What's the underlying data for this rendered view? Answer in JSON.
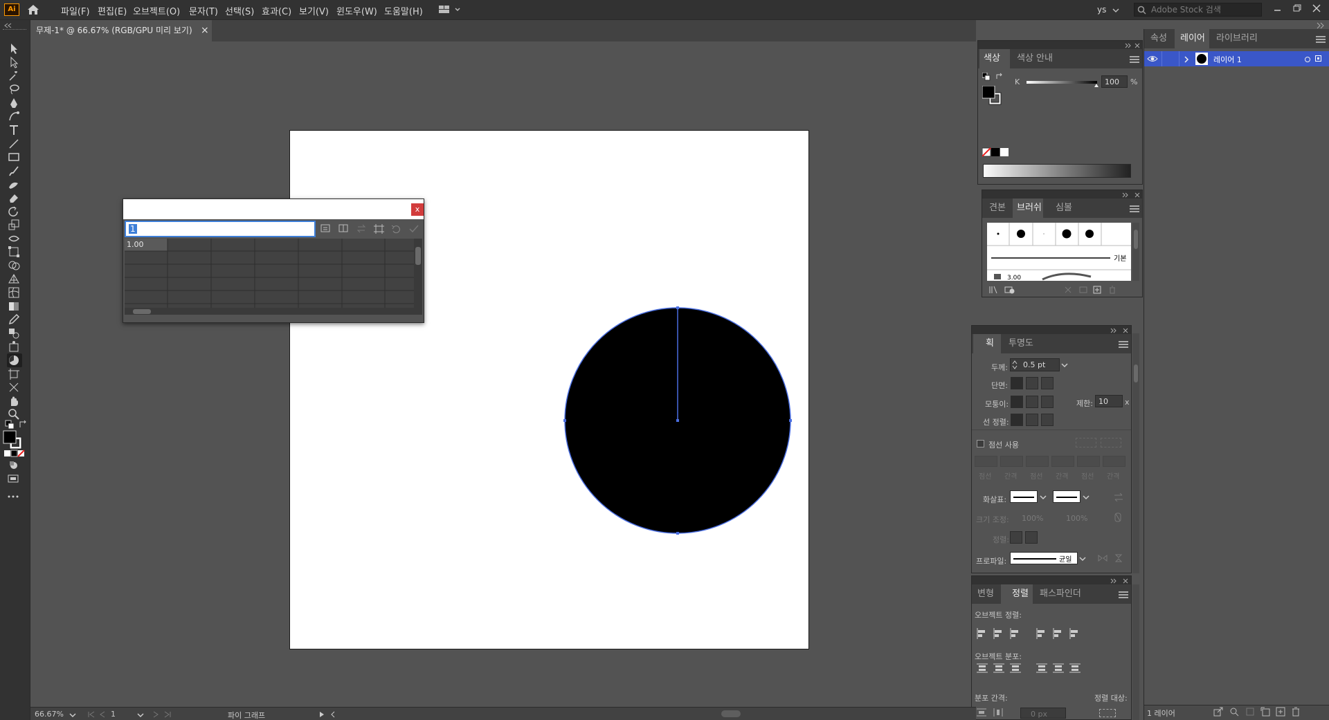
{
  "app": {
    "logo": "Ai"
  },
  "menubar": {
    "items": [
      "파일(F)",
      "편집(E)",
      "오브젝트(O)",
      "문자(T)",
      "선택(S)",
      "효과(C)",
      "보기(V)",
      "윈도우(W)",
      "도움말(H)"
    ],
    "user": "ys",
    "search_placeholder": "Adobe Stock 검색"
  },
  "document": {
    "tab_title": "무제-1* @ 66.67% (RGB/GPU 미리 보기)",
    "close": "×"
  },
  "graph_dialog": {
    "close": "x",
    "input_value": "1",
    "cell_a1": "1.00"
  },
  "color_panel": {
    "tabs": [
      "색상",
      "색상 안내"
    ],
    "channel_label": "K",
    "channel_value": "100",
    "unit": "%"
  },
  "brush_panel": {
    "tabs": [
      "견본",
      "브러쉬",
      "심볼"
    ],
    "basic_label": "기본",
    "size_label": "3.00"
  },
  "stroke_panel": {
    "tabs": [
      "획",
      "투명도"
    ],
    "weight_label": "두께:",
    "weight_value": "0.5 pt",
    "cap_label": "단면:",
    "corner_label": "모퉁이:",
    "limit_label": "제한:",
    "limit_value": "10",
    "limit_unit": "x",
    "align_label": "선 정렬:",
    "dashed_label": "점선 사용",
    "dash_fields": [
      "점선",
      "간격",
      "점선",
      "간격",
      "점선",
      "간격"
    ],
    "arrow_label": "화살표:",
    "scale_label": "크기 조정:",
    "scale_values": [
      "100%",
      "100%"
    ],
    "align2_label": "정렬:",
    "profile_label": "프로파일:",
    "profile_value": "균일"
  },
  "align_panel": {
    "tabs": [
      "변형",
      "정렬",
      "패스파인더"
    ],
    "object_align_label": "오브젝트 정렬:",
    "object_distribute_label": "오브젝트 분포:",
    "distribute_spacing_label": "분포 간격:",
    "align_to_label": "정렬 대상:",
    "spacing_value": "0 px"
  },
  "layers_panel": {
    "tabs": [
      "속성",
      "레이어",
      "라이브러리"
    ],
    "layer_name": "레이어 1",
    "layer_count": "1 레이어"
  },
  "statusbar": {
    "zoom": "66.67%",
    "artboard": "1",
    "tool_name": "파이 그래프"
  },
  "colors": {
    "accent": "#4a7fe0",
    "canvas_bg": "#535353",
    "panel_bg": "#535353",
    "chrome": "#323232",
    "selection": "#3a57c8"
  }
}
